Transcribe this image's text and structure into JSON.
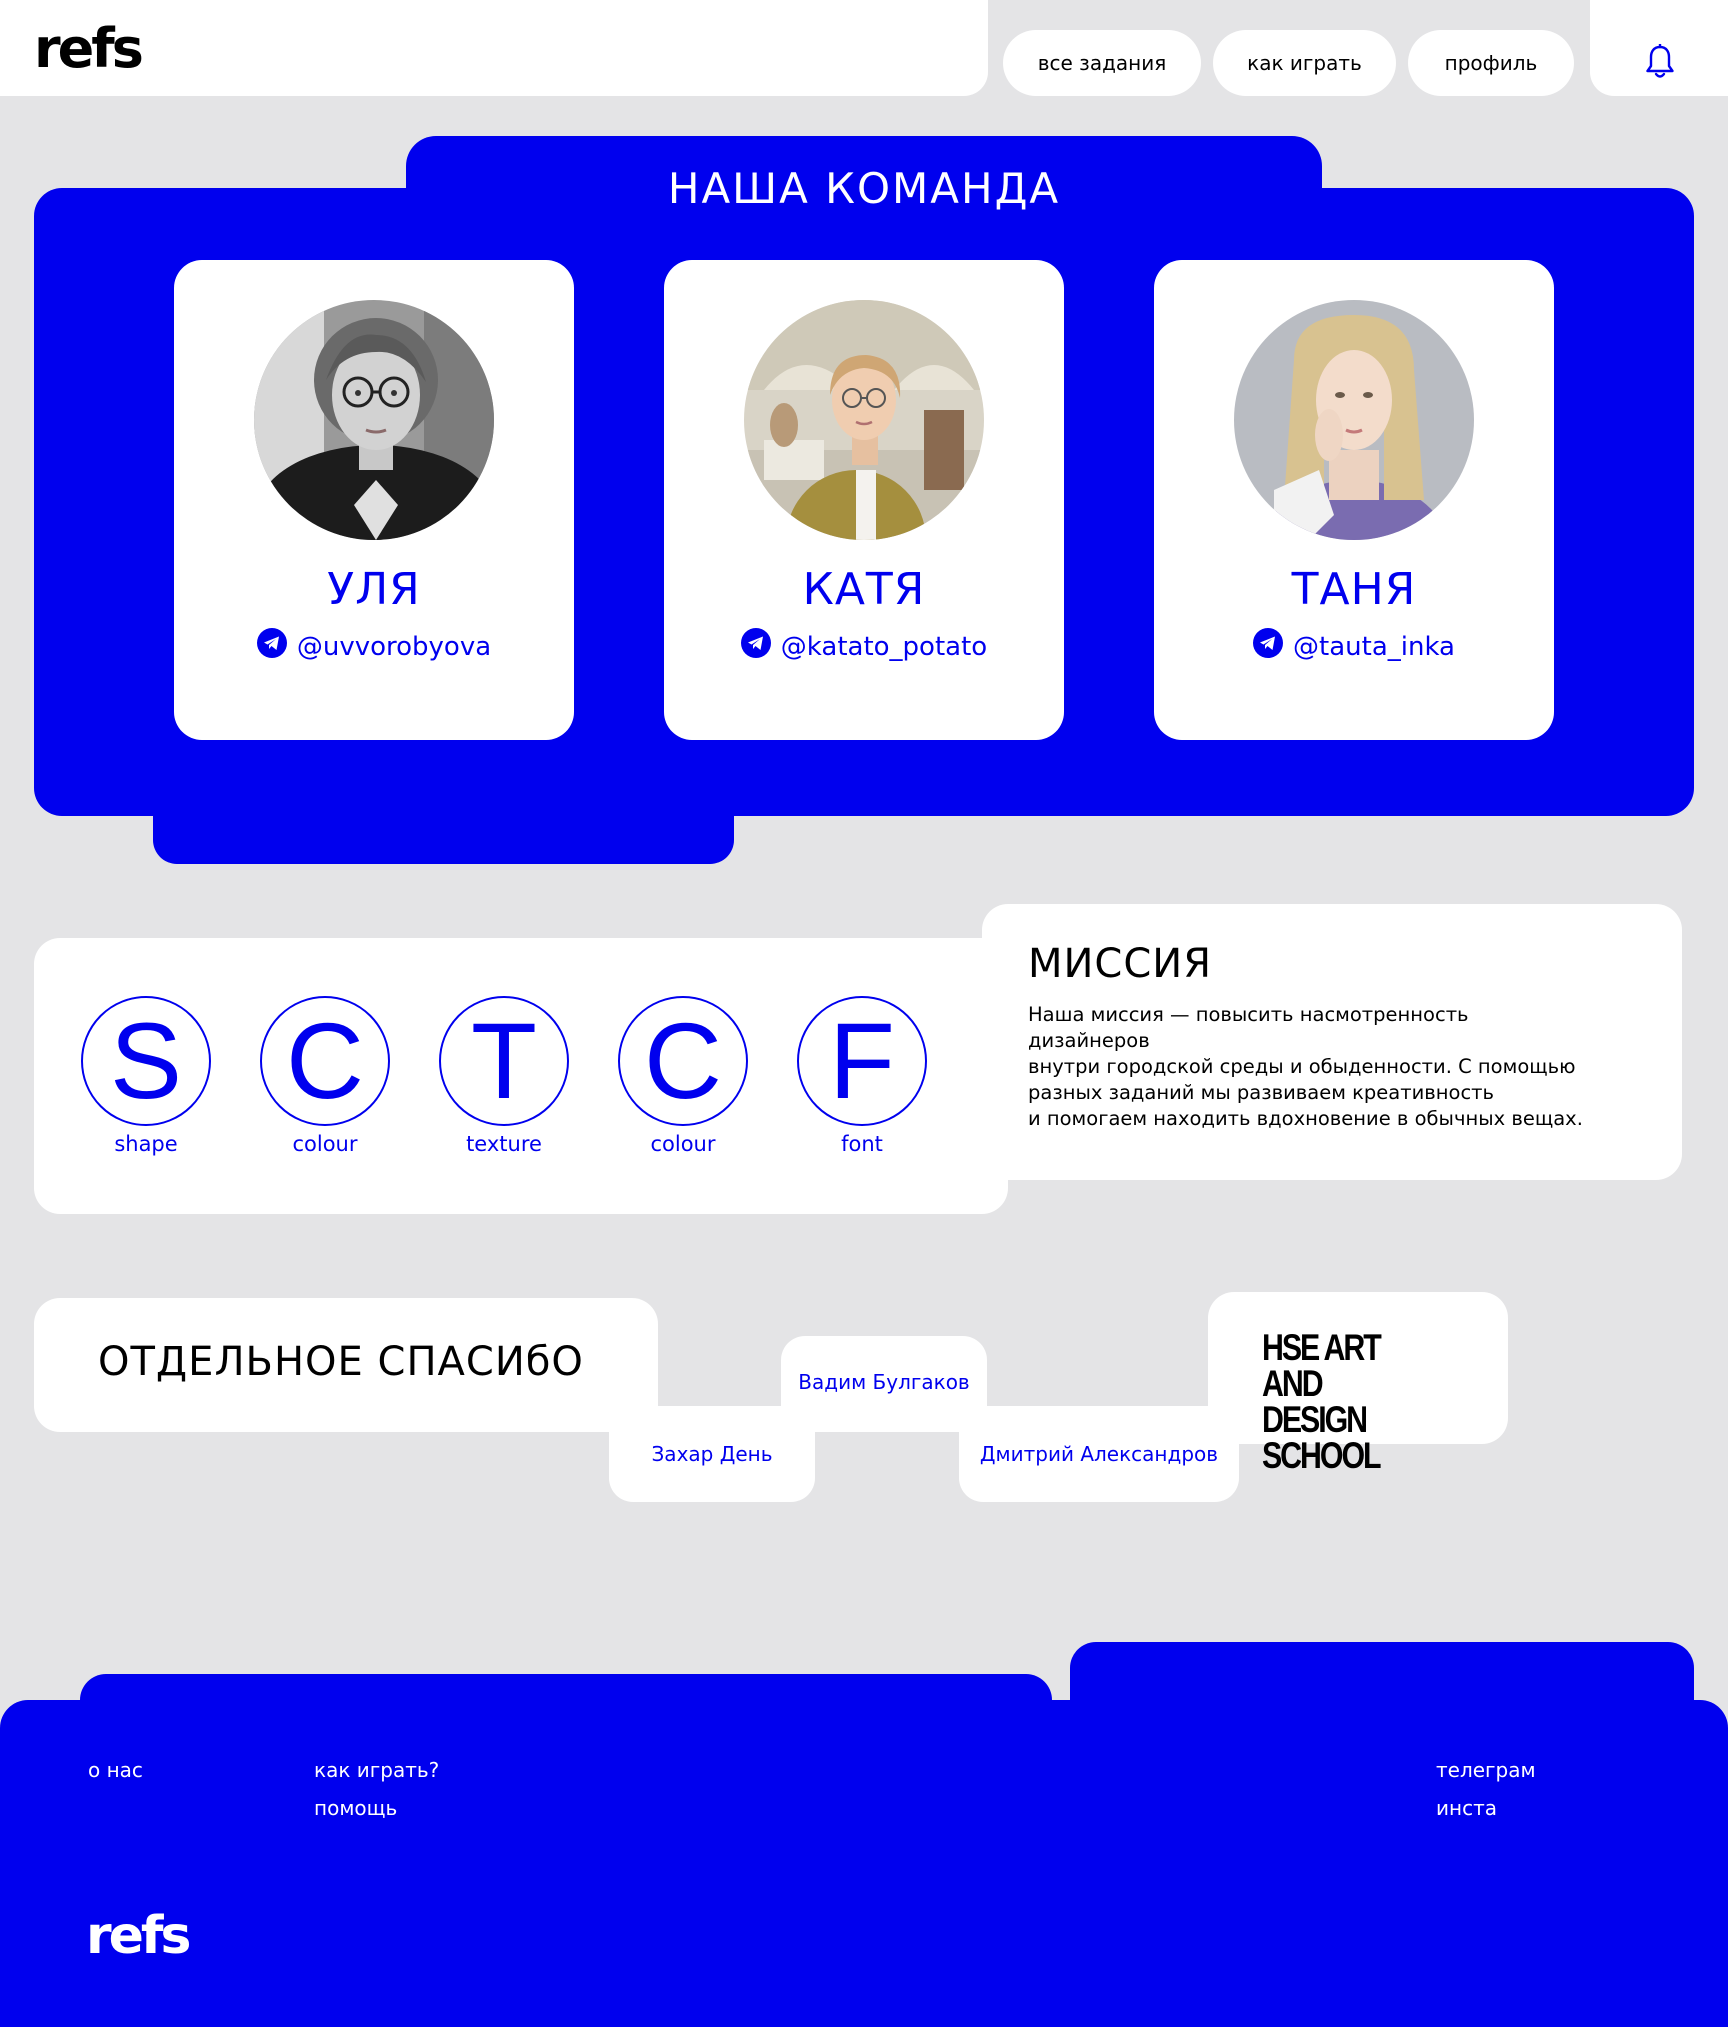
{
  "header": {
    "logo": "refs",
    "nav": [
      "все задания",
      "как играть",
      "профиль"
    ],
    "bell_icon": "bell-icon"
  },
  "team": {
    "title": "НАША  КОМАНДА",
    "members": [
      {
        "name": "УЛЯ",
        "handle": "@uvvorobyova",
        "icon": "telegram-icon"
      },
      {
        "name": "КАТЯ",
        "handle": "@katato_potato",
        "icon": "telegram-icon"
      },
      {
        "name": "ТАНЯ",
        "handle": "@tauta_inka",
        "icon": "telegram-icon"
      }
    ]
  },
  "sctcf": [
    {
      "letter": "S",
      "label": "shape"
    },
    {
      "letter": "C",
      "label": "colour"
    },
    {
      "letter": "T",
      "label": "texture"
    },
    {
      "letter": "C",
      "label": "colour"
    },
    {
      "letter": "F",
      "label": "font"
    }
  ],
  "mission": {
    "title": "МИССИЯ",
    "lines": [
      "Наша миссия — повысить насмотренность дизайнеров",
      "внутри городской среды и обыденности. С помощью",
      "разных заданий мы развиваем креативность",
      "и помогаем находить вдохновение в обычных вещах."
    ]
  },
  "thanks": {
    "title": "ОТДЕЛЬНОЕ  СПАСИбО",
    "people": [
      "Вадим Булгаков",
      "Захар День",
      "Дмитрий Александров"
    ],
    "school_logo": [
      "HSE ART AND",
      "DESIGN SCHOOL"
    ]
  },
  "footer": {
    "col1": [
      "о нас"
    ],
    "col2": [
      "как играть?",
      "помощь"
    ],
    "col3": [
      "телеграм",
      "инста"
    ],
    "logo": "refs"
  },
  "colors": {
    "accent": "#0000ee",
    "background": "#e4e4e6",
    "surface": "#ffffff"
  }
}
